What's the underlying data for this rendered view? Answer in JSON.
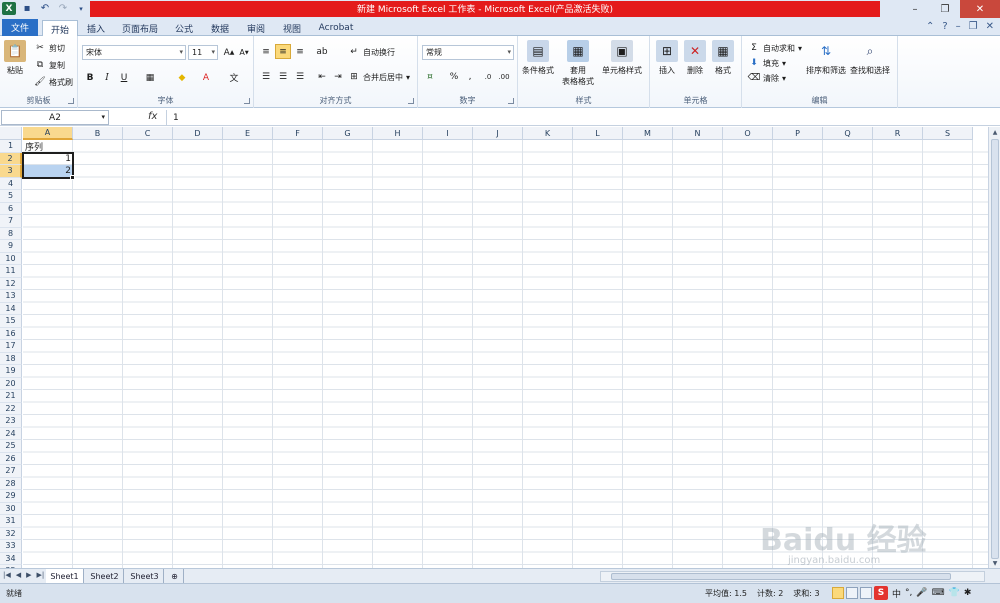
{
  "window": {
    "title": "新建 Microsoft Excel 工作表 - Microsoft Excel(产品激活失败)"
  },
  "ribbon_tabs": [
    {
      "label": "文件"
    },
    {
      "label": "开始"
    },
    {
      "label": "插入"
    },
    {
      "label": "页面布局"
    },
    {
      "label": "公式"
    },
    {
      "label": "数据"
    },
    {
      "label": "审阅"
    },
    {
      "label": "视图"
    },
    {
      "label": "Acrobat"
    }
  ],
  "ribbon": {
    "clipboard": {
      "paste": "粘贴",
      "cut": "剪切",
      "copy": "复制",
      "format_painter": "格式刷",
      "group": "剪贴板"
    },
    "font": {
      "name": "宋体",
      "size": "11",
      "bold": "B",
      "italic": "I",
      "underline": "U",
      "group": "字体"
    },
    "alignment": {
      "wrap": "自动换行",
      "merge": "合并后居中",
      "group": "对齐方式"
    },
    "number": {
      "format": "常规",
      "percent": "%",
      "comma": ",",
      "group": "数字"
    },
    "styles": {
      "conditional": "条件格式",
      "table_fmt_line1": "套用",
      "table_fmt_line2": "表格格式",
      "cell_styles": "单元格样式",
      "group": "样式"
    },
    "cells": {
      "insert": "插入",
      "delete": "删除",
      "format": "格式",
      "group": "单元格"
    },
    "editing": {
      "autosum": "自动求和",
      "fill": "填充",
      "clear": "清除",
      "sort": "排序和筛选",
      "find": "查找和选择",
      "group": "编辑"
    }
  },
  "formula_bar": {
    "name_box": "A2",
    "fx": "fx",
    "content": "1"
  },
  "columns": [
    "A",
    "B",
    "C",
    "D",
    "E",
    "F",
    "G",
    "H",
    "I",
    "J",
    "K",
    "L",
    "M",
    "N",
    "O",
    "P",
    "Q",
    "R",
    "S"
  ],
  "rows": [
    "1",
    "2",
    "3",
    "4",
    "5",
    "6",
    "7",
    "8",
    "9",
    "10",
    "11",
    "12",
    "13",
    "14",
    "15",
    "16",
    "17",
    "18",
    "19",
    "20",
    "21",
    "22",
    "23",
    "24",
    "25",
    "26",
    "27",
    "28",
    "29",
    "30",
    "31",
    "32",
    "33",
    "34",
    "35"
  ],
  "cells": {
    "A1": "序列",
    "A2": "1",
    "A3": "2"
  },
  "sheets": [
    "Sheet1",
    "Sheet2",
    "Sheet3"
  ],
  "status": {
    "mode": "就绪",
    "average": "平均值: 1.5",
    "count": "计数: 2",
    "sum": "求和: 3"
  },
  "ime": {
    "lang": "中"
  },
  "watermark": {
    "main": "Baidu 经验",
    "sub": "jingyan.baidu.com"
  }
}
